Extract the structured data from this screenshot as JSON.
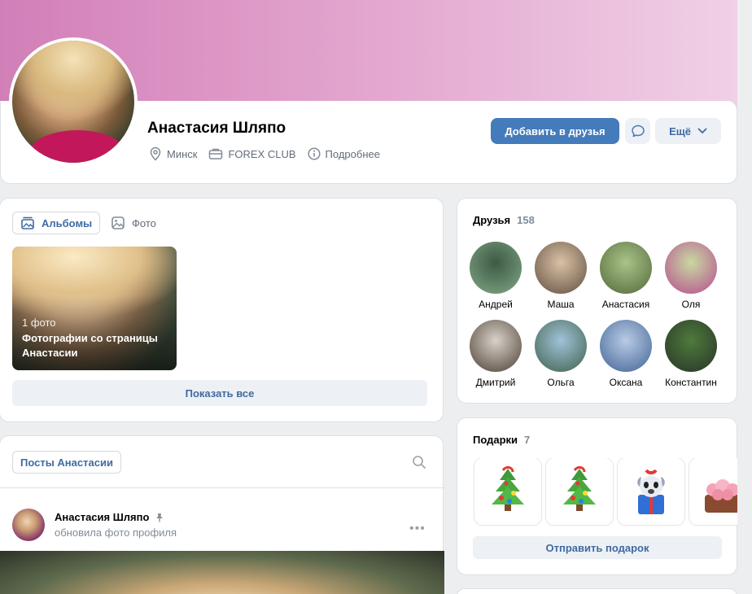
{
  "profile": {
    "name": "Анастасия Шляпо",
    "city": "Минск",
    "work": "FOREX CLUB",
    "details": "Подробнее",
    "add_friend": "Добавить в друзья",
    "more": "Ещё",
    "icons": {
      "city": "location-pin-icon",
      "work": "briefcase-icon",
      "details": "info-icon",
      "message": "message-bubble-icon",
      "more": "chevron-down-icon"
    }
  },
  "photos": {
    "tabs": [
      {
        "label": "Альбомы",
        "icon": "albums-icon",
        "active": true
      },
      {
        "label": "Фото",
        "icon": "photo-icon",
        "active": false
      }
    ],
    "album": {
      "count": "1 фото",
      "title": "Фотографии со страницы Анастасии"
    },
    "show_all": "Показать все"
  },
  "posts": {
    "tab": "Посты Анастасии",
    "item": {
      "author": "Анастасия Шляпо",
      "subtitle": "обновила фото профиля",
      "pinned_icon": "pin-icon",
      "menu_icon": "more-dots-icon"
    }
  },
  "friends": {
    "title": "Друзья",
    "count": "158",
    "items": [
      {
        "name": "Андрей",
        "colors": [
          "#3b5a45",
          "#7da07f"
        ]
      },
      {
        "name": "Маша",
        "colors": [
          "#d9c2a6",
          "#6d5a4a"
        ]
      },
      {
        "name": "Анастасия",
        "colors": [
          "#a9c38a",
          "#5c7240"
        ]
      },
      {
        "name": "Оля",
        "colors": [
          "#c8d9a0",
          "#b85a92"
        ]
      },
      {
        "name": "Дмитрий",
        "colors": [
          "#d8d2c8",
          "#5a4e44"
        ]
      },
      {
        "name": "Ольга",
        "colors": [
          "#9fc3d8",
          "#4a6a5a"
        ]
      },
      {
        "name": "Оксана",
        "colors": [
          "#b9cbe6",
          "#4d6e9c"
        ]
      },
      {
        "name": "Константин",
        "colors": [
          "#4f7a3c",
          "#2b3b2a"
        ]
      }
    ]
  },
  "gifts": {
    "title": "Подарки",
    "count": "7",
    "items": [
      "christmas-tree-gift",
      "christmas-tree-gift",
      "dog-in-box-gift",
      "rose-box-gift"
    ],
    "send": "Отправить подарок"
  },
  "colors": {
    "accent": "#447bba",
    "link": "#3f6ba2",
    "muted": "#818c99"
  }
}
